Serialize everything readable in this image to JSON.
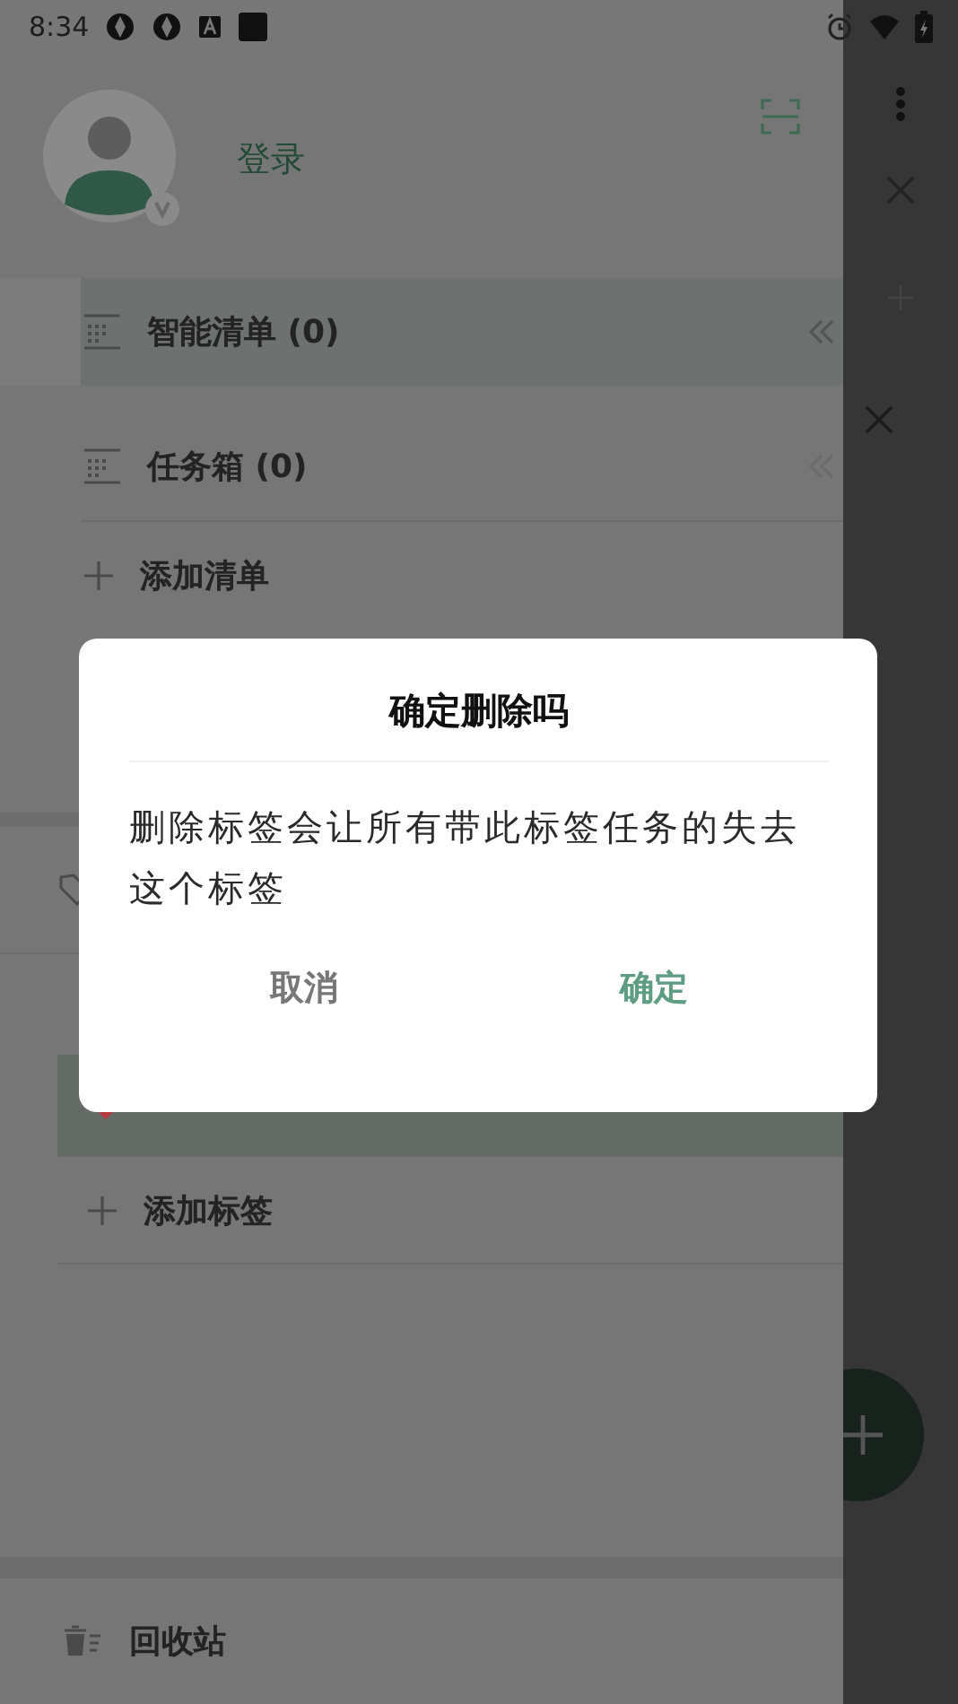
{
  "status_bar": {
    "time": "8:34"
  },
  "drawer": {
    "login": "登录",
    "lists": [
      {
        "label": "智能清单 (0)",
        "selected": true
      },
      {
        "label": "任务箱 (0)",
        "selected": false
      }
    ],
    "add_list": "添加清单",
    "tags": [
      {
        "selected": true,
        "color": "#b8393c"
      }
    ],
    "add_tag": "添加标签",
    "trash": "回收站"
  },
  "dialog": {
    "title": "确定删除吗",
    "message": "删除标签会让所有带此标签任务的失去这个标签",
    "buttons": [
      {
        "label": "取消",
        "kind": "cancel"
      },
      {
        "label": "确定",
        "kind": "confirm"
      }
    ]
  }
}
